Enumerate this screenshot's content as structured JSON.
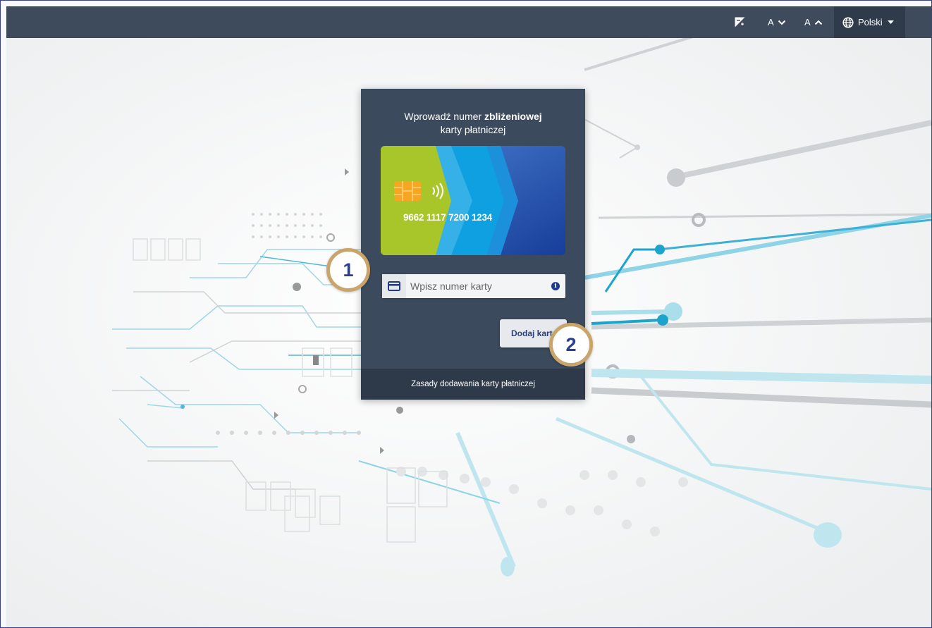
{
  "topbar": {
    "contrast_label": "",
    "font_decrease_label": "A",
    "font_increase_label": "A",
    "language_label": "Polski"
  },
  "panel": {
    "title_prefix": "Wprowadź numer ",
    "title_bold": "zbliżeniowej",
    "title_line2": "karty płatniczej",
    "card_number_example": "9662 1117 7200 1234",
    "input_placeholder": "Wpisz numer karty",
    "input_value": "",
    "info_symbol": "i",
    "add_button_label": "Dodaj kartę",
    "footer_link": "Zasady dodawania karty płatniczej"
  },
  "annotations": {
    "badge_1": "1",
    "badge_2": "2"
  },
  "colors": {
    "topbar": "#3e4b5d",
    "panel": "#3b4a5c",
    "panel_footer": "#2e3a4a",
    "badge_ring": "#c9a56b",
    "badge_text": "#2c3e94",
    "card_green": "#a8c62a",
    "card_blue": "#1e4fa8"
  }
}
